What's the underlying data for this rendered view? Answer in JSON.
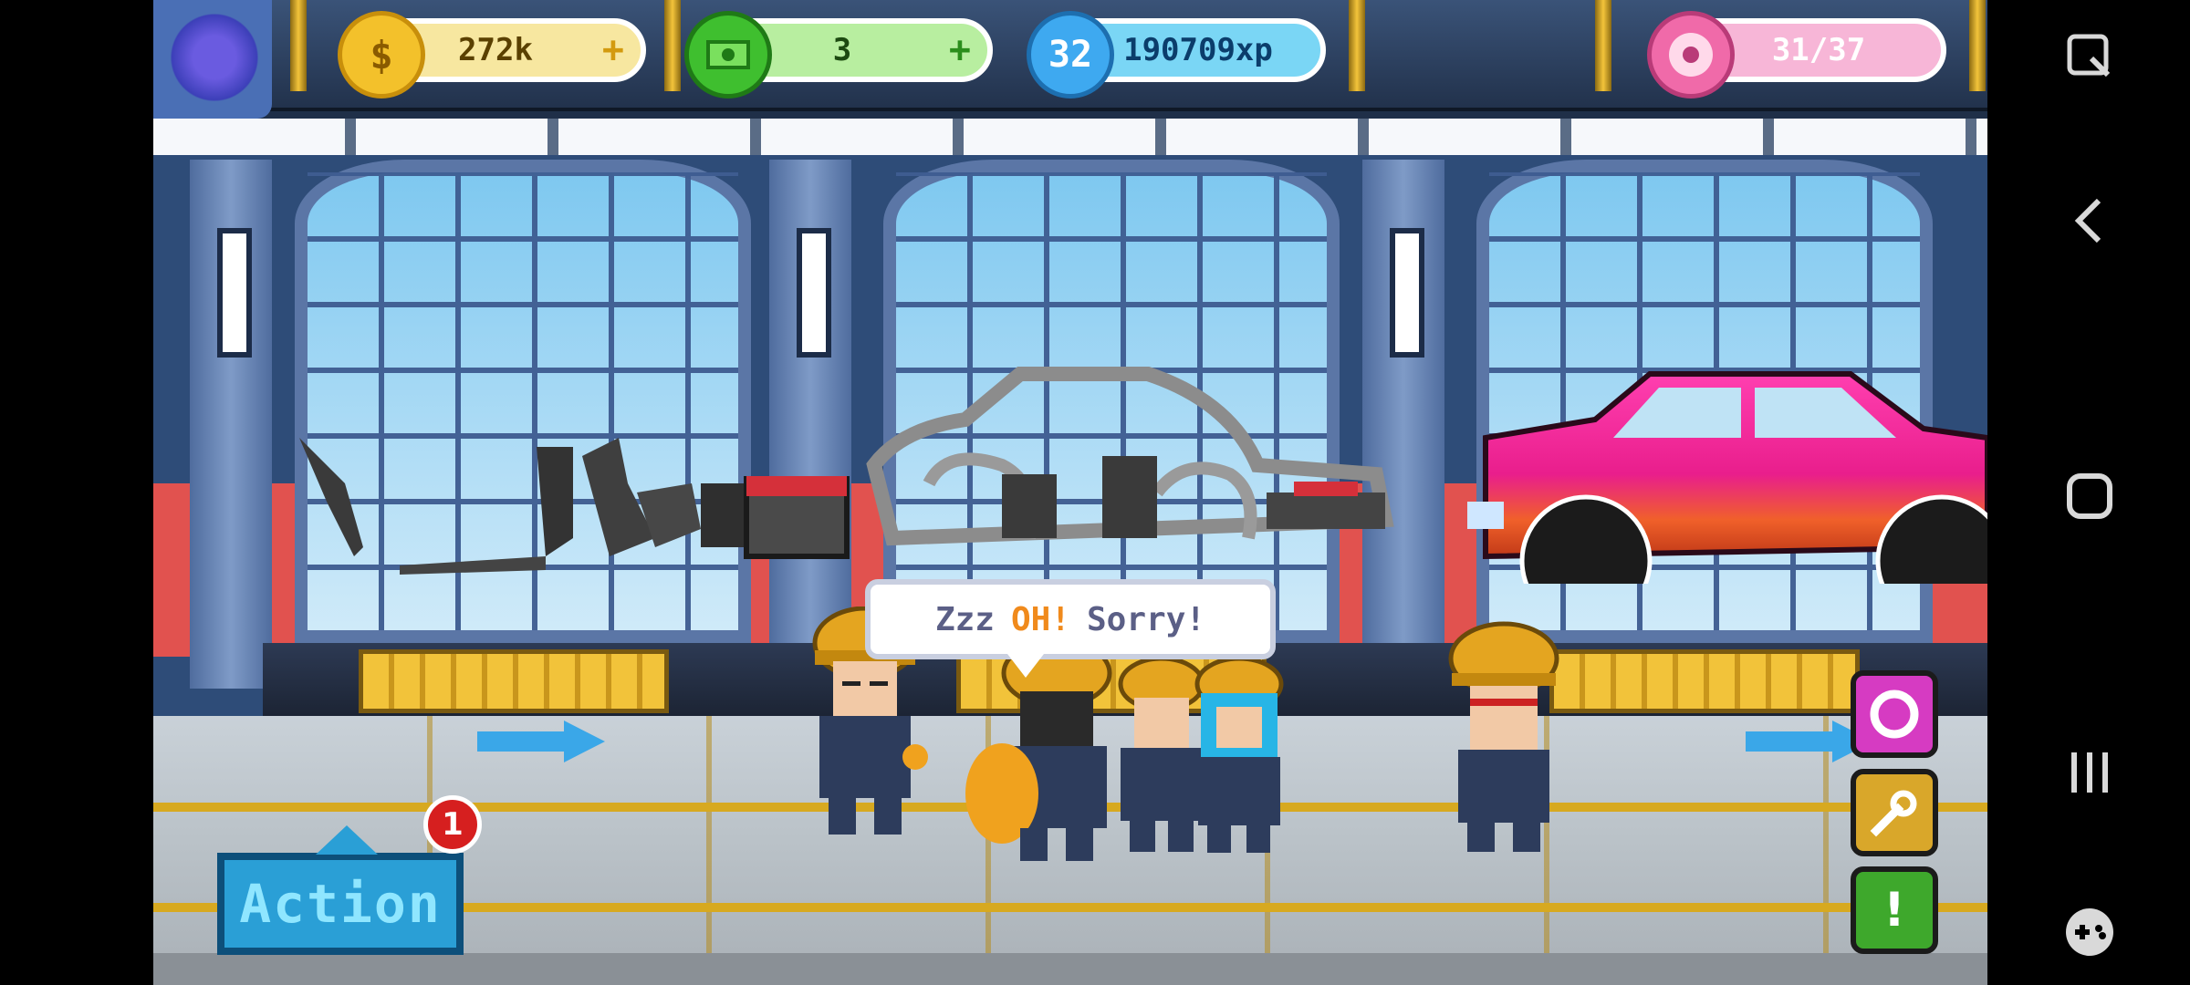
{
  "hud": {
    "coins": "272k",
    "cash": "3",
    "level": "32",
    "xp": "190709xp",
    "donuts": "31/37"
  },
  "speech": {
    "part1": "Zzz",
    "part2": "OH!",
    "part3": "Sorry!"
  },
  "action": {
    "label": "Action",
    "badge_count": "1"
  },
  "icons": {
    "coin": "$",
    "plus": "+",
    "exclaim": "!"
  }
}
